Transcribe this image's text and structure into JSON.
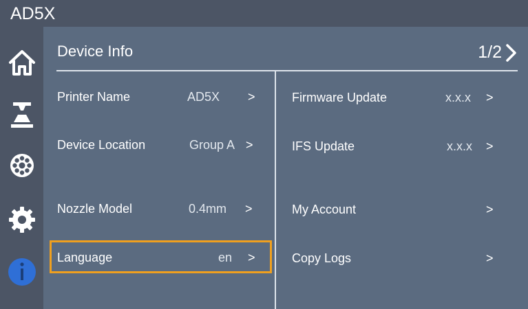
{
  "app": {
    "title": "AD5X"
  },
  "sidebar": {
    "items": [
      {
        "icon": "home-icon"
      },
      {
        "icon": "printer-icon"
      },
      {
        "icon": "filament-spool-icon"
      },
      {
        "icon": "gear-icon"
      },
      {
        "icon": "info-icon",
        "active": true
      }
    ]
  },
  "header": {
    "title": "Device Info",
    "page": "1/2"
  },
  "left_items": [
    {
      "label": "Printer Name",
      "value": "AD5X",
      "chevron": ">"
    },
    {
      "label": "Device Location",
      "value": "Group A",
      "chevron": ">"
    },
    {
      "label": "Nozzle Model",
      "value": "0.4mm",
      "chevron": ">"
    },
    {
      "label": "Language",
      "value": "en",
      "chevron": ">",
      "selected": true
    }
  ],
  "right_items": [
    {
      "label": "Firmware Update",
      "value": "x.x.x",
      "chevron": ">"
    },
    {
      "label": "IFS Update",
      "value": "x.x.x",
      "chevron": ">"
    },
    {
      "label": "My Account",
      "value": "",
      "chevron": ">"
    },
    {
      "label": "Copy Logs",
      "value": "",
      "chevron": ">"
    }
  ],
  "colors": {
    "background": "#5b6b80",
    "sidebar": "#4c5565",
    "accent_selected": "#f0a01e",
    "info_active": "#2f6fd6"
  }
}
